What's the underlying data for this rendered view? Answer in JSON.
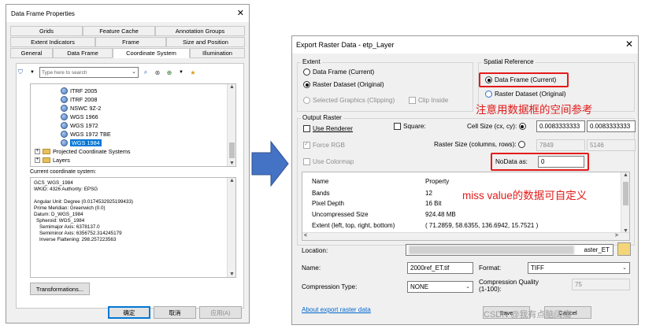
{
  "left_dialog": {
    "title": "Data Frame Properties",
    "tabs_row1": [
      "Grids",
      "Feature Cache",
      "Annotation Groups"
    ],
    "tabs_row2": [
      "Extent Indicators",
      "Frame",
      "Size and Position"
    ],
    "tabs_row3": [
      "General",
      "Data Frame",
      "Coordinate System",
      "Illumination"
    ],
    "active_tab": "Coordinate System",
    "search_placeholder": "Type here to search",
    "tree_items": [
      "ITRF 2005",
      "ITRF 2008",
      "NSWC 9Z-2",
      "WGS 1966",
      "WGS 1972",
      "WGS 1972 TBE",
      "WGS 1984"
    ],
    "selected_item": "WGS 1984",
    "tree_folders": [
      "Projected Coordinate Systems",
      "Layers"
    ],
    "current_cs_label": "Current coordinate system:",
    "current_cs_lines": [
      "GCS_WGS_1984",
      "WKID: 4326 Authority: EPSG",
      "",
      "Angular Unit: Degree (0.0174532925199433)",
      "Prime Meridian: Greenwich (0.0)",
      "Datum: D_WGS_1984",
      "  Spheroid: WGS_1984",
      "    Semimajor Axis: 6378137.0",
      "    Semiminor Axis: 6356752.314245179",
      "    Inverse Flattening: 298.257223563"
    ],
    "transformations_button": "Transformations...",
    "ok_button": "确定",
    "cancel_button": "取消",
    "apply_button": "应用(A)"
  },
  "right_dialog": {
    "title": "Export Raster Data - etp_Layer",
    "extent_label": "Extent",
    "extent_options": [
      "Data Frame (Current)",
      "Raster Dataset (Original)",
      "Selected Graphics (Clipping)"
    ],
    "extent_selected": "Raster Dataset (Original)",
    "clip_inside": "Clip Inside",
    "spatial_ref_label": "Spatial Reference",
    "spatial_ref_options": [
      "Data Frame (Current)",
      "Raster Dataset (Original)"
    ],
    "spatial_ref_selected": "Data Frame (Current)",
    "output_raster_label": "Output Raster",
    "use_renderer": "Use Renderer",
    "square": "Square:",
    "cell_size_label": "Cell Size (cx, cy):",
    "cell_size_x": "0.0083333333",
    "cell_size_y": "0.0083333333",
    "force_rgb": "Force RGB",
    "raster_size_label": "Raster Size (columns, rows):",
    "columns": "7849",
    "rows": "5146",
    "use_colormap": "Use Colormap",
    "nodata_label": "NoData as:",
    "nodata_value": "0",
    "props_headers": [
      "Name",
      "Property"
    ],
    "props_rows": [
      [
        "Bands",
        "12"
      ],
      [
        "Pixel Depth",
        "16 Bit"
      ],
      [
        "Uncompressed Size",
        "924.48 MB"
      ],
      [
        "Extent (left, top, right, bottom)",
        "( 71.2859, 58.6355, 136.6942, 15.7521 )"
      ]
    ],
    "location_label": "Location:",
    "location_value": "aster_ET",
    "name_label": "Name:",
    "name_value": "2000ref_ET.tif",
    "format_label": "Format:",
    "format_value": "TIFF",
    "compression_type_label": "Compression Type:",
    "compression_type_value": "NONE",
    "compression_quality_label": "Compression Quality\n(1-100):",
    "compression_quality_value": "75",
    "about_link": "About export raster data",
    "save_button": "Save",
    "cancel_button": "Cancel"
  },
  "annotations": {
    "spatial_ref_note": "注意用数据框的空间参考",
    "nodata_note": "miss value的数据可自定义"
  },
  "watermark": "CSDN @我有点脑阔痛",
  "colors": {
    "annotation_red": "#e31b1b",
    "arrow_blue": "#4472c4",
    "selection_blue": "#0078d7"
  }
}
